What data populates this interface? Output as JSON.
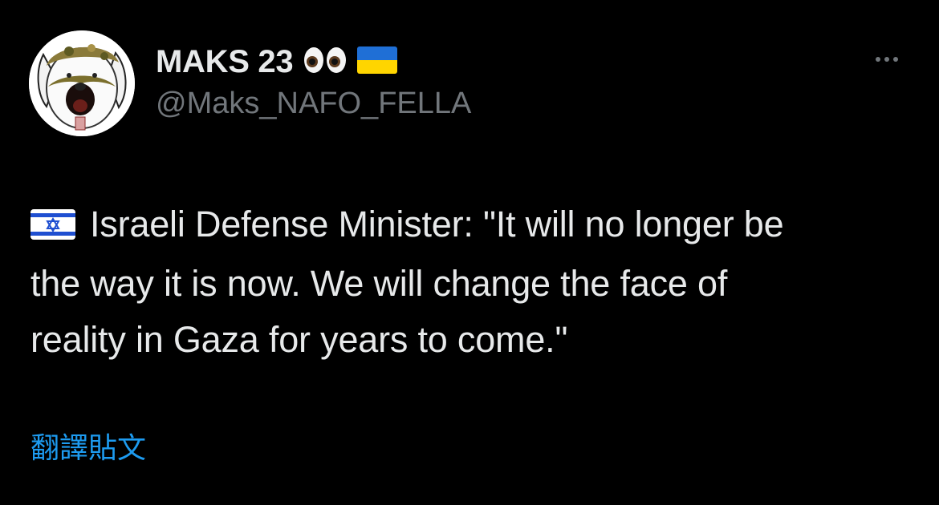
{
  "author": {
    "display_name": "MAKS 23",
    "handle": "@Maks_NAFO_FELLA",
    "name_badges": [
      "eyes-emoji",
      "ukraine-flag-emoji"
    ],
    "avatar_icon": "nafo-dog-avatar"
  },
  "more_icon": "more-horizontal-icon",
  "tweet": {
    "leading_icon": "israel-flag-emoji",
    "lines": [
      "Israeli Defense Minister: \"It will no longer be",
      "the way it is now.  We will change the face of",
      "reality in Gaza for years to come.\""
    ]
  },
  "translate_label": "翻譯貼文",
  "colors": {
    "background": "#000000",
    "primary_text": "#e7e9ea",
    "secondary_text": "#71767b",
    "link": "#1d9bf0"
  }
}
